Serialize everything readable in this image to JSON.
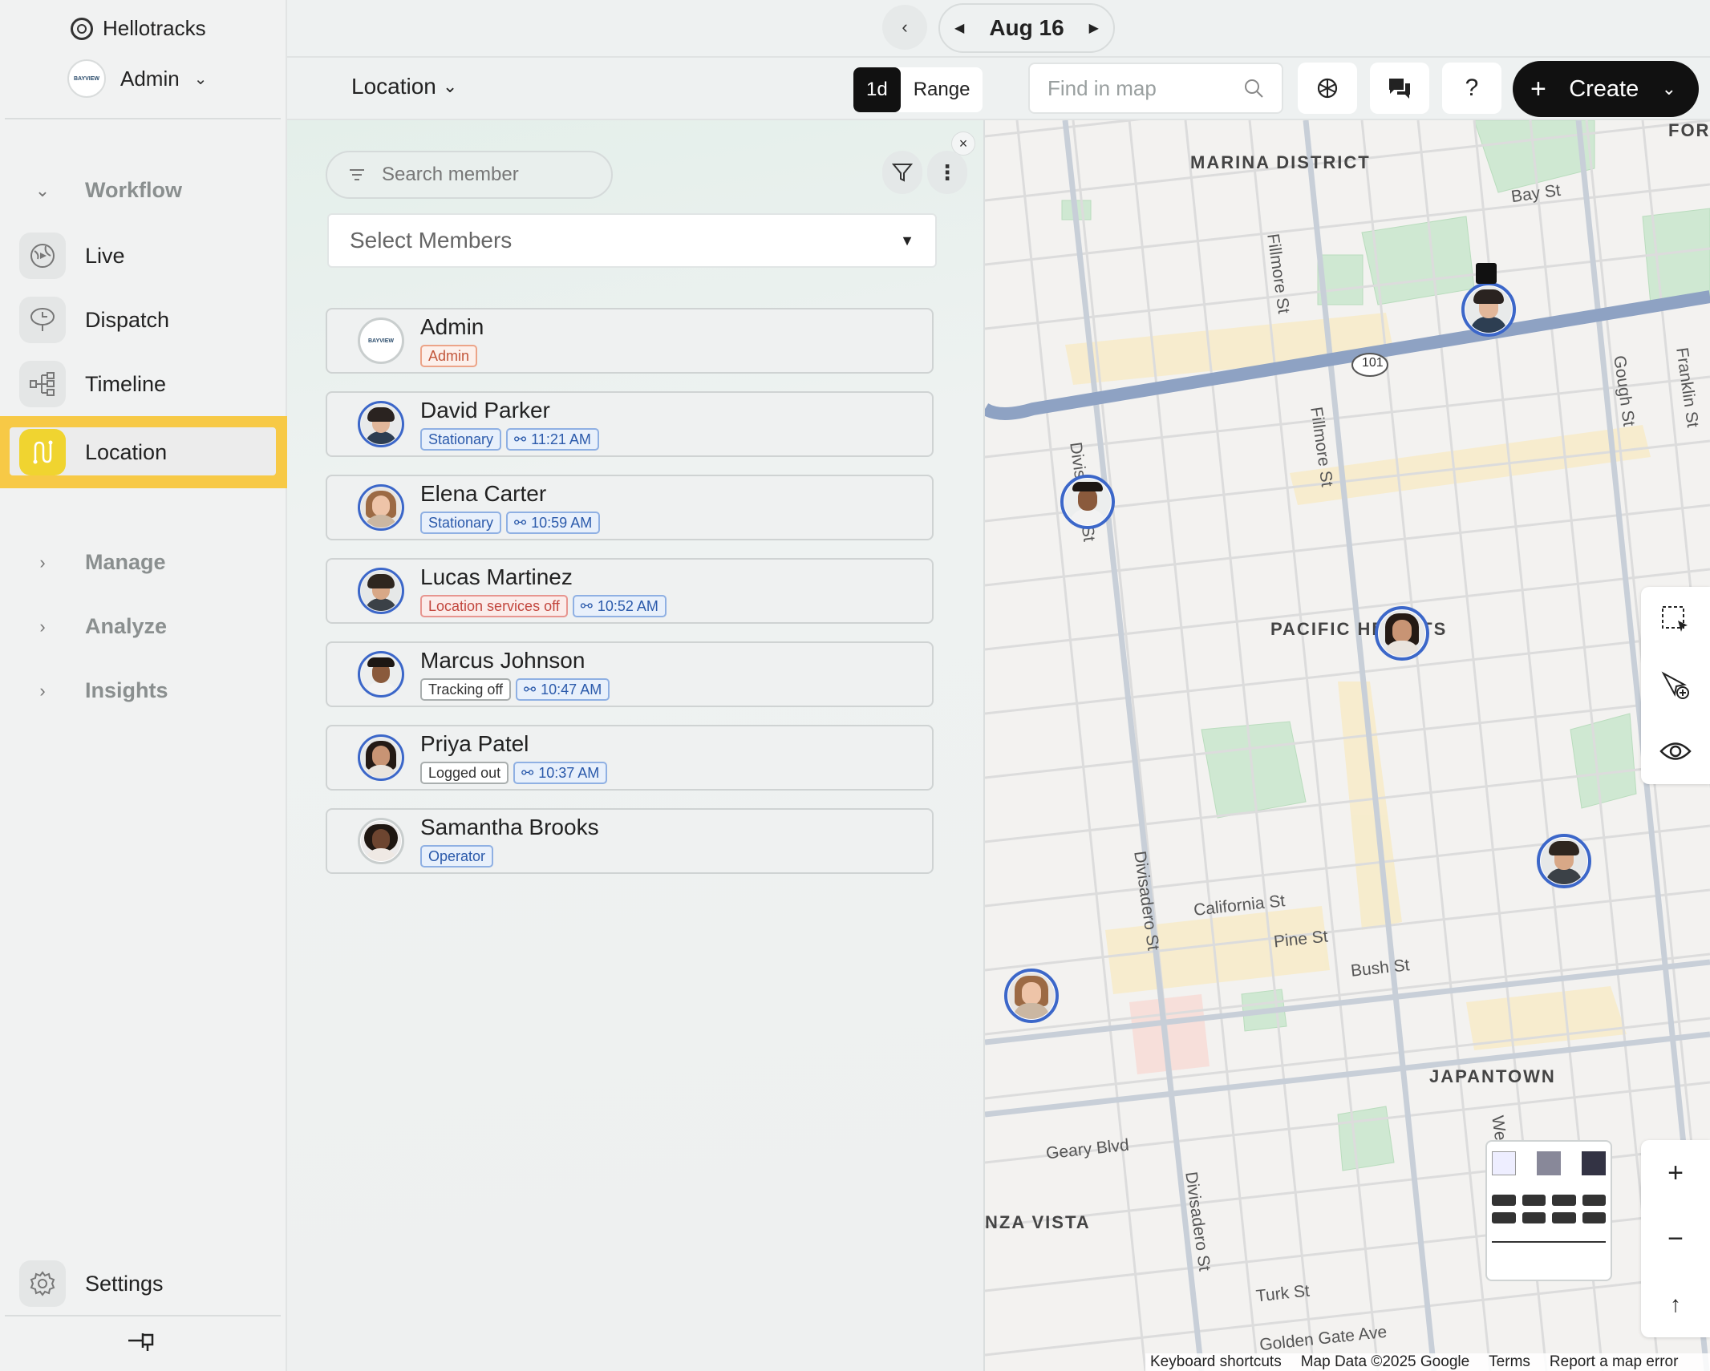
{
  "app": {
    "brand": "Hellotracks",
    "account_name": "Admin",
    "account_logo_text": "BAYVIEW"
  },
  "sidebar": {
    "sections": {
      "workflow": "Workflow",
      "manage": "Manage",
      "analyze": "Analyze",
      "insights": "Insights"
    },
    "items": [
      {
        "label": "Live",
        "icon": "globe-play-icon"
      },
      {
        "label": "Dispatch",
        "icon": "dispatch-sign-icon"
      },
      {
        "label": "Timeline",
        "icon": "timeline-icon"
      },
      {
        "label": "Location",
        "icon": "route-icon",
        "active": true
      }
    ],
    "settings_label": "Settings"
  },
  "datebar": {
    "date": "Aug 16"
  },
  "toolbar": {
    "view": "Location",
    "seg_1d": "1d",
    "seg_range": "Range",
    "find_placeholder": "Find in map",
    "help": "?",
    "create": "Create"
  },
  "panel": {
    "search_placeholder": "Search member",
    "select_members": "Select Members",
    "members": [
      {
        "name": "Admin",
        "tags": [
          {
            "text": "Admin",
            "style": "orange"
          }
        ]
      },
      {
        "name": "David Parker",
        "tags": [
          {
            "text": "Stationary",
            "style": "blue"
          },
          {
            "text": "11:21 AM",
            "style": "blue"
          }
        ]
      },
      {
        "name": "Elena Carter",
        "tags": [
          {
            "text": "Stationary",
            "style": "blue"
          },
          {
            "text": "10:59 AM",
            "style": "blue"
          }
        ]
      },
      {
        "name": "Lucas Martinez",
        "tags": [
          {
            "text": "Location services off",
            "style": "red"
          },
          {
            "text": "10:52 AM",
            "style": "blue"
          }
        ]
      },
      {
        "name": "Marcus Johnson",
        "tags": [
          {
            "text": "Tracking off",
            "style": "gray"
          },
          {
            "text": "10:47 AM",
            "style": "blue"
          }
        ]
      },
      {
        "name": "Priya Patel",
        "tags": [
          {
            "text": "Logged out",
            "style": "gray"
          },
          {
            "text": "10:37 AM",
            "style": "blue"
          }
        ]
      },
      {
        "name": "Samantha Brooks",
        "tags": [
          {
            "text": "Operator",
            "style": "blue"
          }
        ]
      }
    ]
  },
  "map": {
    "districts": {
      "marina": "MARINA DISTRICT",
      "fort": "FORT",
      "pacific": "PACIFIC HEIGHTS",
      "japantown": "JAPANTOWN",
      "anza": "NZA VISTA"
    },
    "streets": {
      "bay": "Bay St",
      "fillmore1": "Fillmore St",
      "fillmore2": "Fillmore St",
      "gough": "Gough St",
      "franklin": "Franklin St",
      "divisadero_top": "Divisadero St",
      "divisadero1": "Divisadero St",
      "divisadero2": "Divisadero St",
      "california": "California St",
      "pine": "Pine St",
      "bush": "Bush St",
      "geary": "Geary Blvd",
      "turk": "Turk St",
      "golden_gate": "Golden Gate Ave",
      "hwy": "101",
      "webster": "We"
    },
    "footer": {
      "shortcuts": "Keyboard shortcuts",
      "data": "Map Data ©2025 Google",
      "terms": "Terms",
      "report": "Report a map error"
    }
  }
}
